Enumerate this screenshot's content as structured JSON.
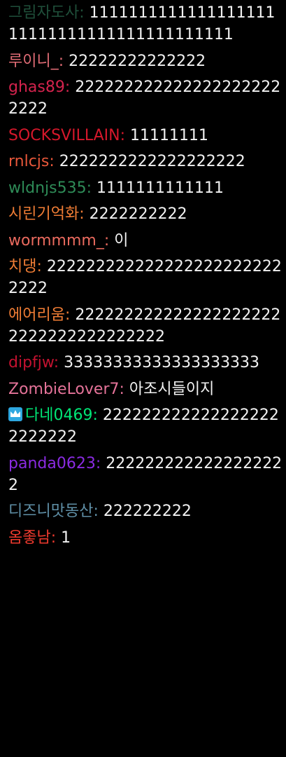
{
  "colors": {
    "background": "#000000",
    "message_text": "#f2f2f2"
  },
  "messages": [
    {
      "user": "그림자도사",
      "text": "111111111111111111111111111111111111111111",
      "color": "#1f4f3a"
    },
    {
      "user": "루이니_",
      "text": "22222222222222",
      "color": "#e06c75"
    },
    {
      "user": "ghas89",
      "text": "2222222222222222222222222",
      "color": "#d4234d"
    },
    {
      "user": "SOCKSVILLAIN",
      "text": "11111111",
      "color": "#d6182b"
    },
    {
      "user": "rnlcjs",
      "text": "2222222222222222222",
      "color": "#e8573a"
    },
    {
      "user": "wldnjs535",
      "text": "1111111111111",
      "color": "#2e8b57"
    },
    {
      "user": "시린기억화",
      "text": "2222222222",
      "color": "#f07d35"
    },
    {
      "user": "wormmmm_",
      "text": "이",
      "color": "#ea6a5e"
    },
    {
      "user": "치댕",
      "text": "2222222222222222222222222222",
      "color": "#f07d35"
    },
    {
      "user": "에어리움",
      "text": "2222222222222222222222222222222222222",
      "color": "#f07d35"
    },
    {
      "user": "dipfjw",
      "text": "33333333333333333333",
      "color": "#c41230"
    },
    {
      "user": "ZombieLover7",
      "text": "아조시들이지",
      "color": "#e57399"
    },
    {
      "user": "다네0469",
      "text": "2222222222222222222222222",
      "color": "#00e676",
      "badge": "crown-badge-icon"
    },
    {
      "user": "panda0623",
      "text": "2222222222222222222",
      "color": "#8a2be2"
    },
    {
      "user": "디즈니맛동산",
      "text": "222222222",
      "color": "#5f8fa6"
    },
    {
      "user": "옴좋남",
      "text": "1",
      "color": "#f03a2e"
    }
  ]
}
